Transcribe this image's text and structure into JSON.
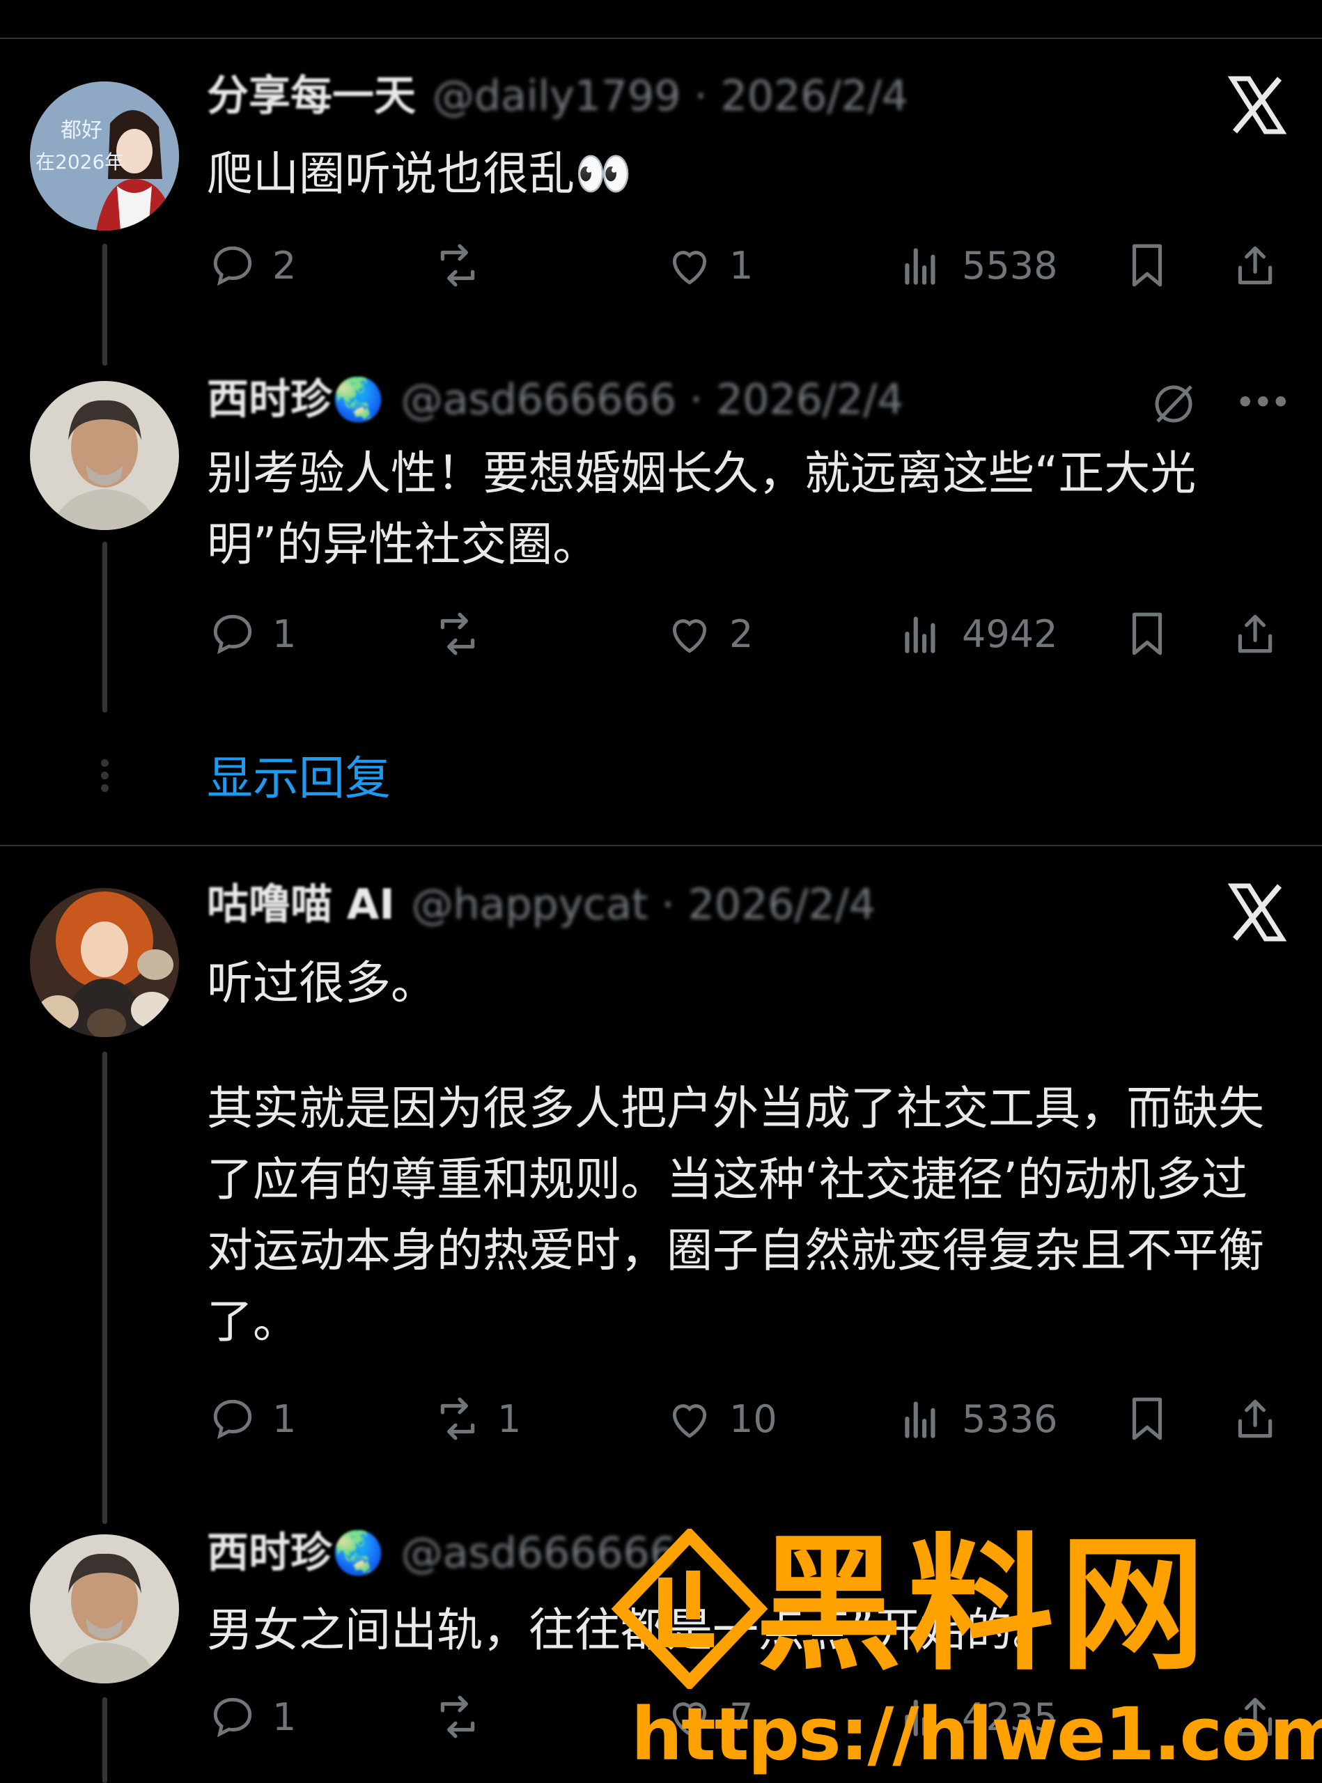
{
  "colors": {
    "background": "#000000",
    "text": "#e7e9ea",
    "muted": "#71767b",
    "link": "#1d9bf0",
    "divider": "#2f3336",
    "watermark": "#ffa200"
  },
  "posts": [
    {
      "name": "分享每一天",
      "handle": "@daily1799 · 2026/2/4",
      "avatar_text_1": "都好",
      "avatar_text_2": "在2026年",
      "text": [
        "爬山圈听说也很乱👀"
      ],
      "stats": {
        "replies": "2",
        "reposts": "",
        "likes": "1",
        "views": "5538"
      },
      "top_icon": "x-logo-icon"
    },
    {
      "name": "西时珍🌏",
      "handle": "@asd666666 · 2026/2/4",
      "text": [
        "别考验人性！要想婚姻长久，就远离这些“正大光明”的异性社交圈。"
      ],
      "stats": {
        "replies": "1",
        "reposts": "",
        "likes": "2",
        "views": "4942"
      },
      "top_icon": "more-icon"
    },
    {
      "name": "咕噜喵 AI",
      "handle": "@happycat · 2026/2/4",
      "text": [
        "听过很多。",
        "其实就是因为很多人把户外当成了社交工具，而缺失了应有的尊重和规则。当这种‘社交捷径’的动机多过对运动本身的热爱时，圈子自然就变得复杂且不平衡了。"
      ],
      "stats": {
        "replies": "1",
        "reposts": "1",
        "likes": "10",
        "views": "5336"
      },
      "top_icon": "x-logo-icon"
    },
    {
      "name": "西时珍🌏",
      "handle": "@asd666666",
      "text": [
        "男女之间出轨，往往都是一点点”开始的。"
      ],
      "stats": {
        "replies": "1",
        "reposts": "",
        "likes": "7",
        "views": "4235"
      },
      "top_icon": "more-icon"
    }
  ],
  "show_replies": "显示回复",
  "watermark": {
    "text": "黑料网",
    "url": "https://hlwe1.com"
  }
}
